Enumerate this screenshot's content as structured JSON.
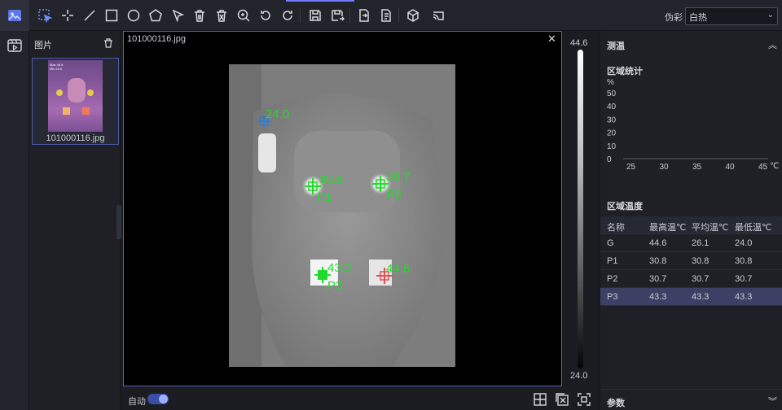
{
  "toolbar": {
    "palette_label": "伪彩",
    "palette_value": "白热",
    "tools": [
      "select-tool",
      "point-tool",
      "line-tool",
      "rect-tool",
      "circle-tool",
      "polygon-tool",
      "pointer-tool",
      "delete-tool",
      "delete-all-tool",
      "zoom-tool",
      "rotate-left-tool",
      "rotate-right-tool",
      "save-tool",
      "save-as-tool",
      "export-tool",
      "export-report-tool",
      "3d-tool",
      "wifi-tool"
    ]
  },
  "image_panel": {
    "title": "图片",
    "files": [
      {
        "name": "101000116.jpg"
      }
    ]
  },
  "viewer": {
    "title": "101000116.jpg",
    "close_glyph": "✕",
    "markers": [
      {
        "id": "G",
        "value": "24.0",
        "label": ""
      },
      {
        "id": "P1",
        "value": "30.8",
        "label": "P1"
      },
      {
        "id": "P2",
        "value": "30.7",
        "label": "P2"
      },
      {
        "id": "P3",
        "value": "43.3",
        "label": "P3"
      },
      {
        "id": "hot",
        "value": "44.6",
        "label": ""
      }
    ]
  },
  "color_scale": {
    "max": "44.6",
    "min": "24.0"
  },
  "bottom_bar": {
    "auto_label": "自动",
    "auto_on": true
  },
  "right_panel": {
    "measure_title": "测温",
    "stats_title": "区域统计",
    "chart_data": {
      "type": "bar",
      "ylabel": "%",
      "xunit": "℃",
      "yticks": [
        0,
        10,
        20,
        30,
        40,
        50
      ],
      "xticks": [
        25,
        30,
        35,
        40,
        45
      ],
      "ylim": [
        0,
        50
      ],
      "xlim": [
        25,
        45
      ],
      "values": []
    },
    "region_title": "区域温度",
    "table": {
      "headers": [
        "名称",
        "最高温℃",
        "平均温℃",
        "最低温℃"
      ],
      "rows": [
        [
          "G",
          "44.6",
          "26.1",
          "24.0"
        ],
        [
          "P1",
          "30.8",
          "30.8",
          "30.8"
        ],
        [
          "P2",
          "30.7",
          "30.7",
          "30.7"
        ],
        [
          "P3",
          "43.3",
          "43.3",
          "43.3"
        ]
      ],
      "selected_index": 3
    },
    "params_title": "参数"
  },
  "colors": {
    "accent": "#6d7bff",
    "marker_green": "#1fdc2a",
    "marker_blue": "#2a7fd8",
    "marker_red": "#e05050"
  }
}
